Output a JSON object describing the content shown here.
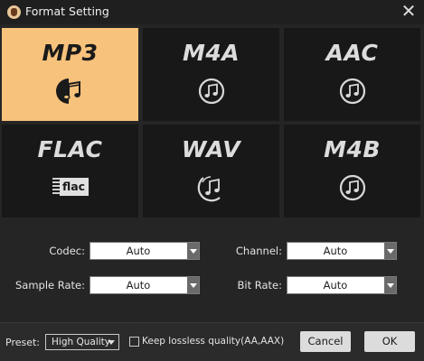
{
  "window": {
    "title": "Format Setting",
    "close_glyph": "✕"
  },
  "formats": [
    {
      "name": "MP3",
      "icon": "music-note-half-icon",
      "selected": true
    },
    {
      "name": "M4A",
      "icon": "music-note-circle-icon",
      "selected": false
    },
    {
      "name": "AAC",
      "icon": "music-note-circle-icon",
      "selected": false
    },
    {
      "name": "FLAC",
      "icon": "flac-badge-icon",
      "badge_text": "flac",
      "selected": false
    },
    {
      "name": "WAV",
      "icon": "music-note-swirl-icon",
      "selected": false
    },
    {
      "name": "M4B",
      "icon": "music-note-circle-icon",
      "selected": false
    }
  ],
  "settings": {
    "codec": {
      "label": "Codec:",
      "value": "Auto"
    },
    "channel": {
      "label": "Channel:",
      "value": "Auto"
    },
    "sample_rate": {
      "label": "Sample Rate:",
      "value": "Auto"
    },
    "bit_rate": {
      "label": "Bit Rate:",
      "value": "Auto"
    }
  },
  "footer": {
    "preset_label": "Preset:",
    "preset_value": "High Quality",
    "keep_lossless_label": "Keep lossless quality(AA,AAX)",
    "keep_lossless_checked": false,
    "cancel_label": "Cancel",
    "ok_label": "OK"
  },
  "colors": {
    "background": "#252525",
    "tile": "#181818",
    "tile_selected": "#f7c27c",
    "text": "#e0e0e0"
  }
}
